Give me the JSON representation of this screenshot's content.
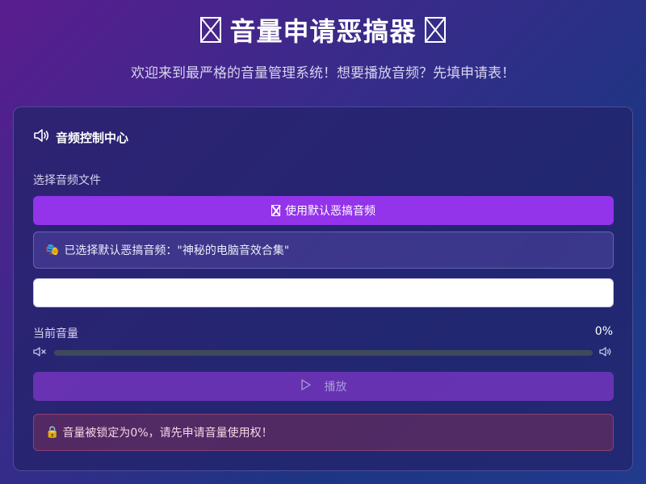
{
  "header": {
    "title": "音量申请恶搞器",
    "subtitle": "欢迎来到最严格的音量管理系统！想要播放音频？先填申请表！"
  },
  "panel": {
    "title": "音频控制中心",
    "file_label": "选择音频文件",
    "default_button_label": "使用默认恶搞音频",
    "selected_emoji": "🎭",
    "selected_text": "已选择默认恶搞音频：\"神秘的电脑音效合集\"",
    "input_value": "",
    "input_placeholder": "",
    "volume_label": "当前音量",
    "volume_value": "0%",
    "volume_level": 0,
    "play_label": "播放",
    "alert_emoji": "🔒",
    "alert_text": "音量被锁定为0%，请先申请音量使用权！"
  },
  "colors": {
    "accent": "#9333ea",
    "track": "#3e4a5c"
  },
  "icons": [
    "speaker-icon",
    "mute-icon",
    "volume-icon",
    "play-icon",
    "lock-icon",
    "mask-icon"
  ]
}
